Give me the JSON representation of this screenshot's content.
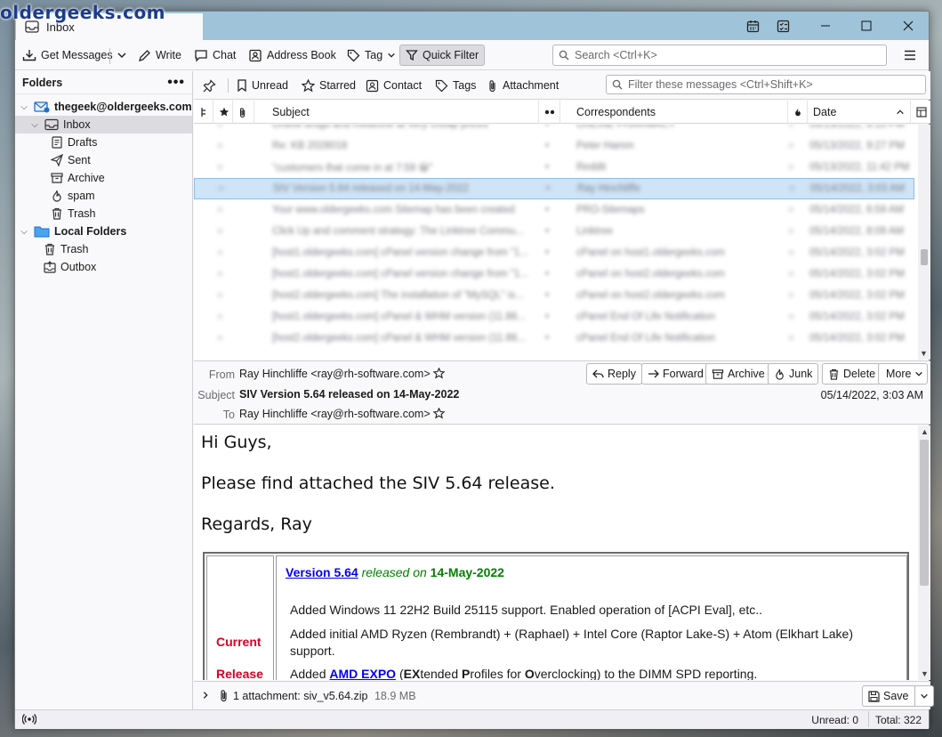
{
  "watermark": "oldergeeks.com",
  "tab": {
    "title": "Inbox"
  },
  "toolbar": {
    "get_messages": "Get Messages",
    "write": "Write",
    "chat": "Chat",
    "address_book": "Address Book",
    "tag": "Tag",
    "quick_filter": "Quick Filter",
    "search_placeholder": "Search <Ctrl+K>"
  },
  "folders": {
    "header": "Folders",
    "account": "thegeek@oldergeeks.com",
    "items": [
      "Inbox",
      "Drafts",
      "Sent",
      "Archive",
      "spam",
      "Trash"
    ],
    "local_folders": "Local Folders",
    "local_items": [
      "Trash",
      "Outbox"
    ]
  },
  "quickfilter": {
    "unread": "Unread",
    "starred": "Starred",
    "contact": "Contact",
    "tags": "Tags",
    "attachment": "Attachment",
    "filter_placeholder": "Filter these messages <Ctrl+Shift+K>"
  },
  "columns": {
    "subject": "Subject",
    "correspondents": "Correspondents",
    "date": "Date"
  },
  "threads": [
    {
      "subject": "Online drugs and medicine at very cheap prices",
      "from": "ONLINE PHARMACY",
      "date": "05/13/2022, 9:15 PM"
    },
    {
      "subject": "Re: KB 2028018",
      "from": "Peter Hamm",
      "date": "05/13/2022, 9:27 PM"
    },
    {
      "subject": "\"customers that come in at 7:59 😀\"",
      "from": "Reddit",
      "date": "05/13/2022, 11:42 PM"
    },
    {
      "subject": "SIV Version 5.64 released on 14-May-2022",
      "from": "Ray Hinchliffe",
      "date": "05/14/2022, 3:03 AM"
    },
    {
      "subject": "Your www.oldergeeks.com Sitemap has been created",
      "from": "PRO-Sitemaps",
      "date": "05/14/2022, 6:59 AM"
    },
    {
      "subject": "Click Up and comment strategy: The Linktree Commu...",
      "from": "Linktree",
      "date": "05/14/2022, 8:09 AM"
    },
    {
      "subject": "[host1.oldergeeks.com] cPanel version change from \"1...",
      "from": "cPanel on host1.oldergeeks.com",
      "date": "05/14/2022, 3:02 PM"
    },
    {
      "subject": "[host1.oldergeeks.com] cPanel version change from \"1...",
      "from": "cPanel on host2.oldergeeks.com",
      "date": "05/14/2022, 3:02 PM"
    },
    {
      "subject": "[host2.oldergeeks.com] The installation of \"MySQL\" is...",
      "from": "cPanel on host2.oldergeeks.com",
      "date": "05/14/2022, 3:02 PM"
    },
    {
      "subject": "[host1.oldergeeks.com] cPanel & WHM version (11.86...",
      "from": "cPanel End Of Life Notification",
      "date": "05/14/2022, 3:02 PM"
    },
    {
      "subject": "[host2.oldergeeks.com] cPanel & WHM version (11.86...",
      "from": "cPanel End Of Life Notification",
      "date": "05/14/2022, 3:02 PM"
    }
  ],
  "message": {
    "from_label": "From",
    "from": "Ray Hinchliffe <ray@rh-software.com>",
    "subject_label": "Subject",
    "subject": "SIV Version 5.64 released on 14-May-2022",
    "to_label": "To",
    "to": "Ray Hinchliffe <ray@rh-software.com>",
    "date": "05/14/2022, 3:03 AM",
    "buttons": {
      "reply": "Reply",
      "forward": "Forward",
      "archive": "Archive",
      "junk": "Junk",
      "delete": "Delete",
      "more": "More"
    }
  },
  "body": {
    "greeting": "Hi Guys,",
    "line1": "Please find attached the SIV 5.64 release.",
    "signoff": "Regards, Ray",
    "release_left_1": "Current",
    "release_left_2": "Release",
    "version_link": "Version 5.64",
    "released_on": "released on",
    "release_date": "14-May-2022",
    "item1": "Added Windows 11 22H2 Build 25115 support. Enabled operation of [ACPI Eval], etc..",
    "item2": "Added initial AMD Ryzen (Rembrandt) + (Raphael) + Intel Core (Raptor Lake-S) + Atom (Elkhart Lake) support.",
    "item3_a": "Added ",
    "item3_link": "AMD EXPO",
    "item3_b1": " (",
    "item3_b2": "EX",
    "item3_b3": "tended ",
    "item3_b4": "P",
    "item3_b5": "rofiles for ",
    "item3_b6": "O",
    "item3_b7": "verclocking) to the DIMM SPD reporting."
  },
  "attachment": {
    "label": "1 attachment:",
    "name": "siv_v5.64.zip",
    "size": "18.9 MB",
    "save": "Save"
  },
  "status": {
    "unread": "Unread: 0",
    "total": "Total: 322"
  },
  "colors": {
    "accent": "#0060df",
    "link": "#0000ee",
    "green": "#008000",
    "red": "#d70022",
    "titlebar": "#9fc3d9"
  }
}
